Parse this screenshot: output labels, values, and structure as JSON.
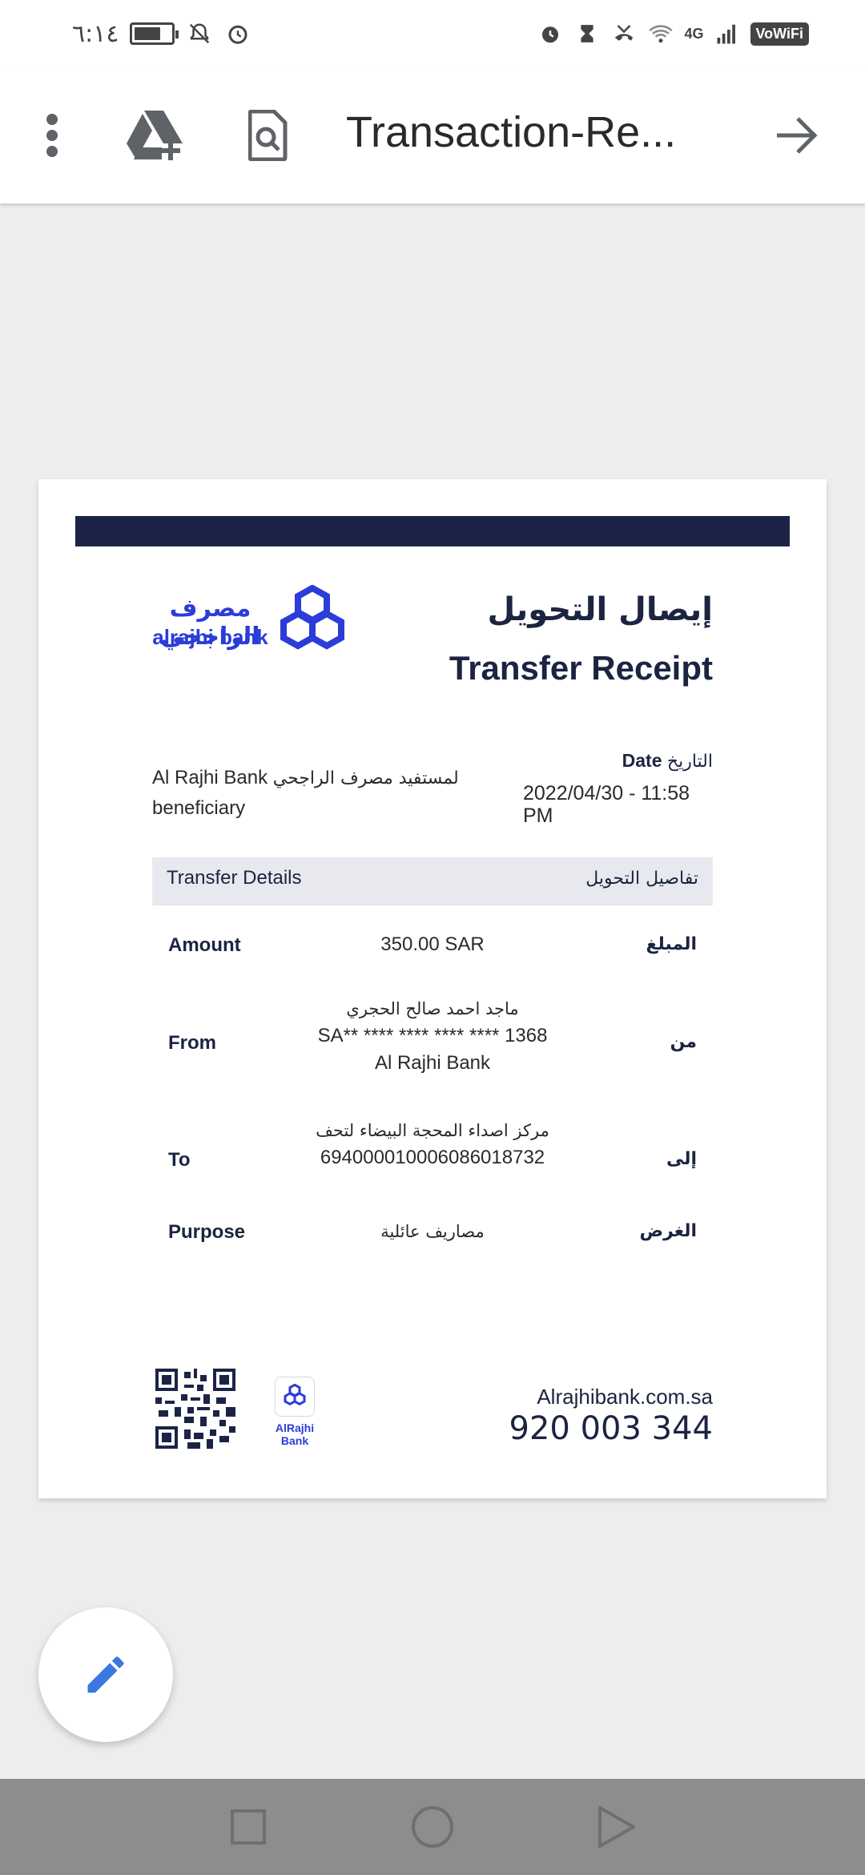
{
  "status_bar": {
    "time": "٦:١٤",
    "battery_level": 0.75,
    "network": "4G",
    "vowifi": "VoWiFi",
    "icons": [
      "battery-icon",
      "mute-icon",
      "alarm-icon",
      "alarm-icon",
      "hourglass-icon",
      "missed-call-icon",
      "wifi-icon",
      "signal-icon"
    ]
  },
  "toolbar": {
    "title": "Transaction-Re...",
    "icons": [
      "more-vert-icon",
      "add-to-drive-icon",
      "find-in-page-icon",
      "open-arrow-icon"
    ]
  },
  "receipt": {
    "logo": {
      "ar": "مصرف الراجحي",
      "en": "alrajhi bank"
    },
    "title_ar": "إيصال التحويل",
    "title_en": "Transfer Receipt",
    "beneficiary_line1_en": "Al Rajhi Bank",
    "beneficiary_line1_ar": "لمستفيد مصرف الراجحي",
    "beneficiary_line2": "beneficiary",
    "date_label_en": "Date",
    "date_label_ar": "التاريخ",
    "date_value": "2022/04/30 - 11:58 PM",
    "details_header_en": "Transfer Details",
    "details_header_ar": "تفاصيل التحويل",
    "amount": {
      "label_en": "Amount",
      "label_ar": "المبلغ",
      "value": "350.00 SAR"
    },
    "from": {
      "label_en": "From",
      "label_ar": "من",
      "name": "ماجد احمد صالح الحجري",
      "account": "SA** **** **** **** **** 1368",
      "bank": "Al Rajhi Bank"
    },
    "to": {
      "label_en": "To",
      "label_ar": "إلى",
      "name": "مركز اصداء المحجة البيضاء لتحف",
      "account": "694000010006086018732"
    },
    "purpose": {
      "label_en": "Purpose",
      "label_ar": "الغرض",
      "value": "مصاريف عائلية"
    },
    "footer": {
      "mini_logo_label": "AlRajhi Bank",
      "website": "Alrajhibank.com.sa",
      "phone": "920 003 344"
    }
  },
  "colors": {
    "navy": "#1b2447",
    "brand_blue": "#2b3cd8",
    "fab_icon": "#3a78e0"
  }
}
